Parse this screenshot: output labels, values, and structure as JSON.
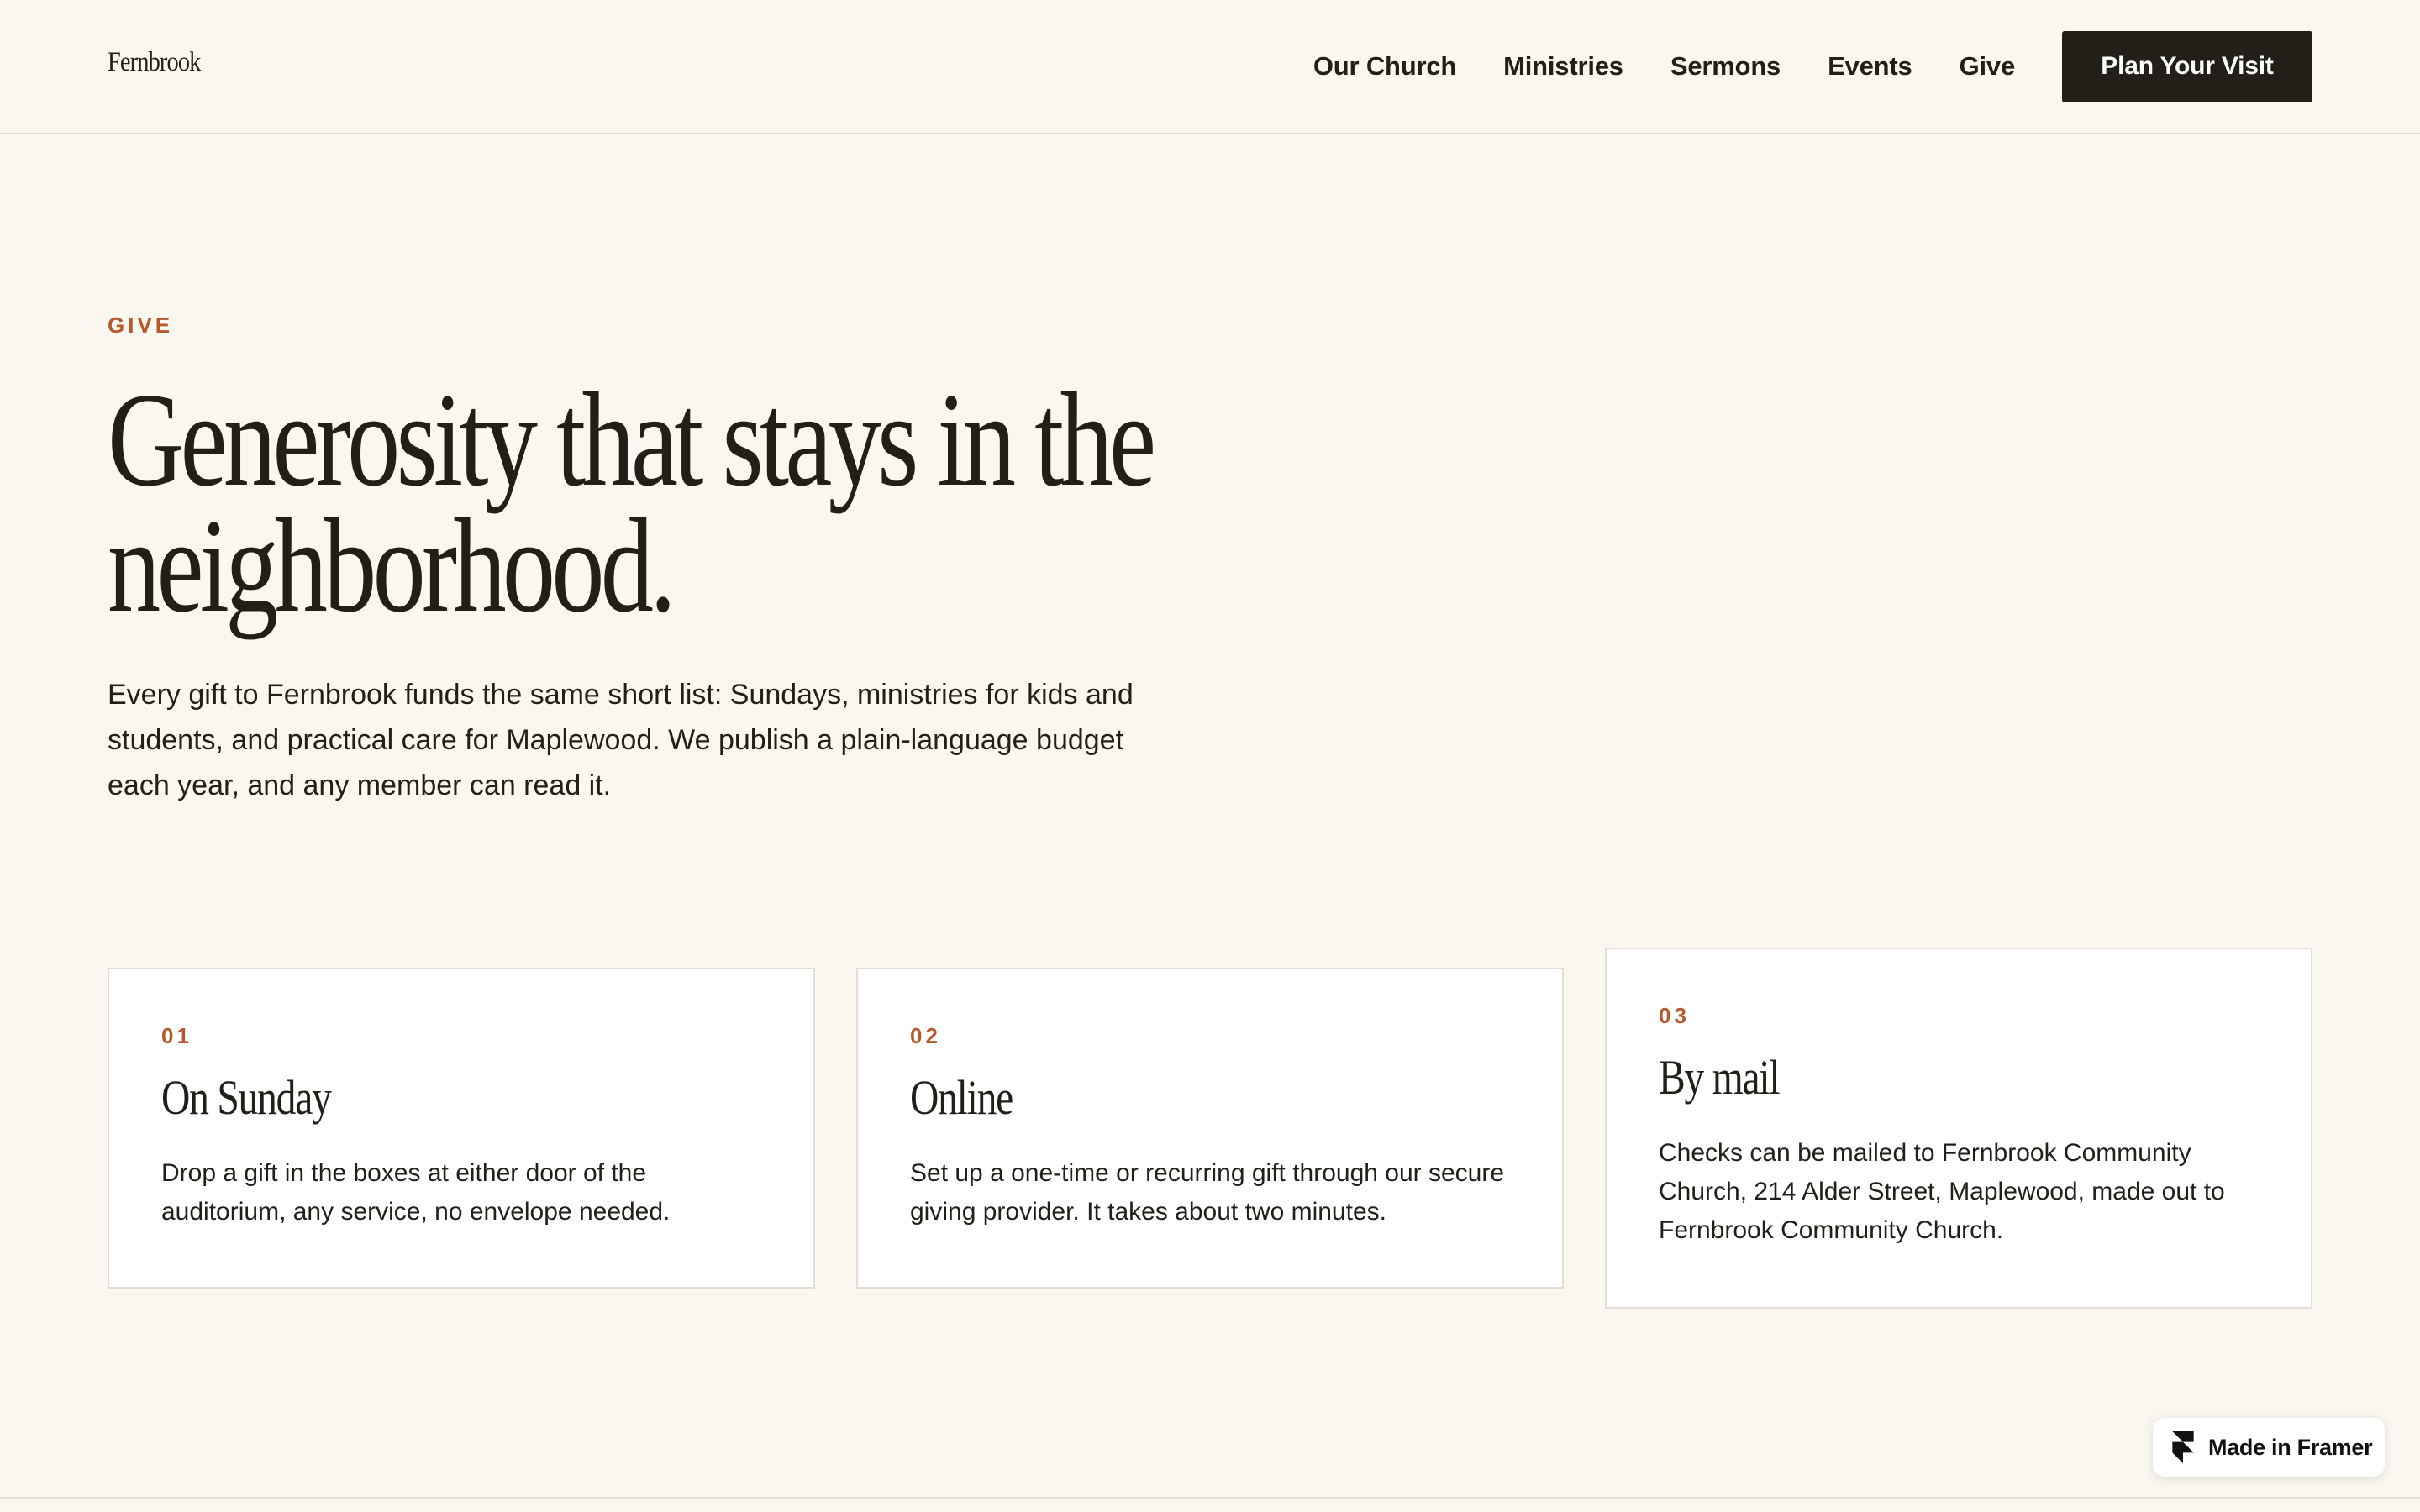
{
  "header": {
    "logo": "Fernbrook",
    "nav": [
      {
        "label": "Our Church"
      },
      {
        "label": "Ministries"
      },
      {
        "label": "Sermons"
      },
      {
        "label": "Events"
      },
      {
        "label": "Give"
      }
    ],
    "cta_label": "Plan Your Visit"
  },
  "hero": {
    "eyebrow": "GIVE",
    "title_line_1": "Generosity that stays in the",
    "title_line_2": "neighborhood.",
    "body": "Every gift to Fernbrook funds the same short list: Sundays, ministries for kids and students, and practical care for Maplewood. We publish a plain-language budget each year, and any member can read it."
  },
  "cards": [
    {
      "number": "01",
      "title": "On Sunday",
      "body": "Drop a gift in the boxes at either door of the auditorium, any service, no envelope needed."
    },
    {
      "number": "02",
      "title": "Online",
      "body": "Set up a one-time or recurring gift through our secure giving provider. It takes about two minutes."
    },
    {
      "number": "03",
      "title": "By mail",
      "body": "Checks can be mailed to Fernbrook Community Church, 214 Alder Street, Maplewood, made out to Fernbrook Community Church."
    }
  ],
  "badge": {
    "label": "Made in Framer",
    "icon": "framer-icon"
  },
  "colors": {
    "background": "#faf7f0",
    "text": "#221e18",
    "accent": "#b65a2b",
    "card": "#ffffff",
    "border": "#e3ddd2",
    "button": "#221e18"
  }
}
